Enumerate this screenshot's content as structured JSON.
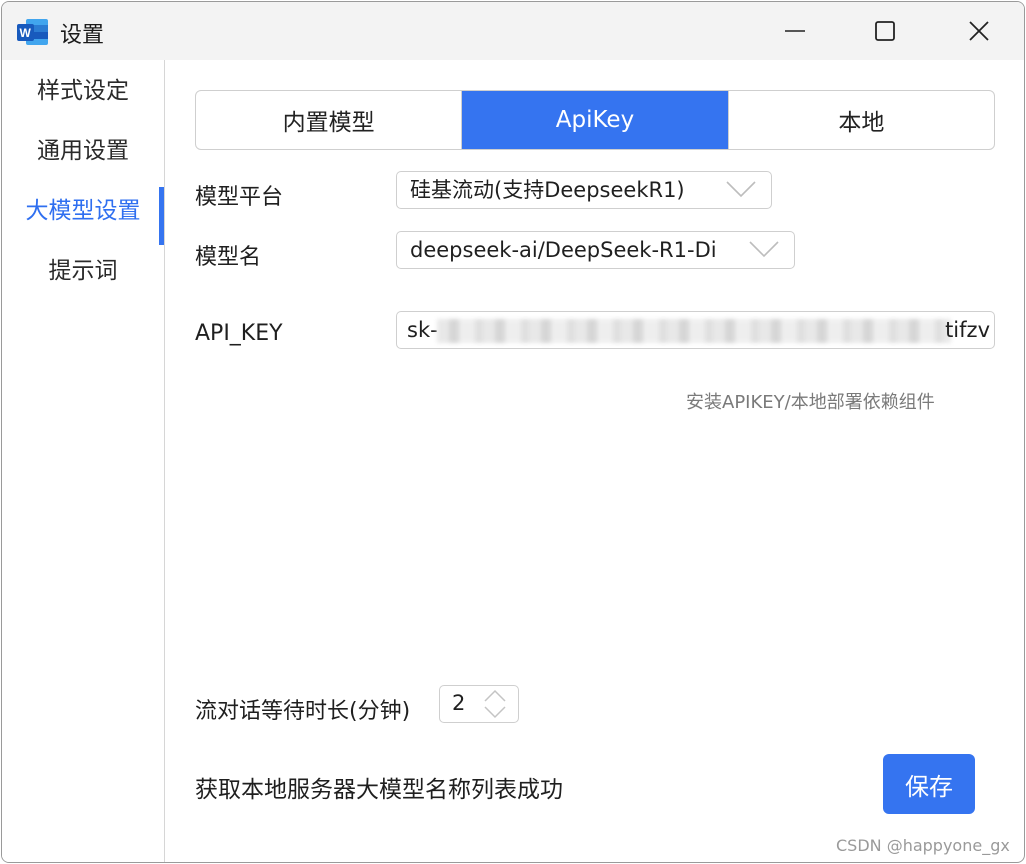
{
  "window": {
    "title": "设置"
  },
  "sidebar": {
    "items": [
      {
        "label": "样式设定",
        "active": false
      },
      {
        "label": "通用设置",
        "active": false
      },
      {
        "label": "大模型设置",
        "active": true
      },
      {
        "label": "提示词",
        "active": false
      }
    ]
  },
  "tabs": [
    {
      "label": "内置模型",
      "active": false
    },
    {
      "label": "ApiKey",
      "active": true
    },
    {
      "label": "本地",
      "active": false
    }
  ],
  "form": {
    "platform_label": "模型平台",
    "platform_value": "硅基流动(支持DeepseekR1)",
    "model_label": "模型名",
    "model_value": "deepseek-ai/DeepSeek-R1-Di",
    "apikey_label": "API_KEY",
    "apikey_prefix": "sk-",
    "apikey_suffix": "tifzv",
    "install_link": "安装APIKEY/本地部署依赖组件",
    "wait_label": "流对话等待时长(分钟)",
    "wait_value": "2"
  },
  "status_text": "获取本地服务器大模型名称列表成功",
  "save_label": "保存",
  "watermark": "CSDN @happyone_gx",
  "colors": {
    "accent": "#3574f0",
    "titlebar": "#f3f3f3",
    "word_icon": "#185abd"
  },
  "icons": [
    "word-app-icon",
    "minimize-icon",
    "maximize-icon",
    "close-icon",
    "chevron-down-icon",
    "spin-arrows-icon"
  ]
}
